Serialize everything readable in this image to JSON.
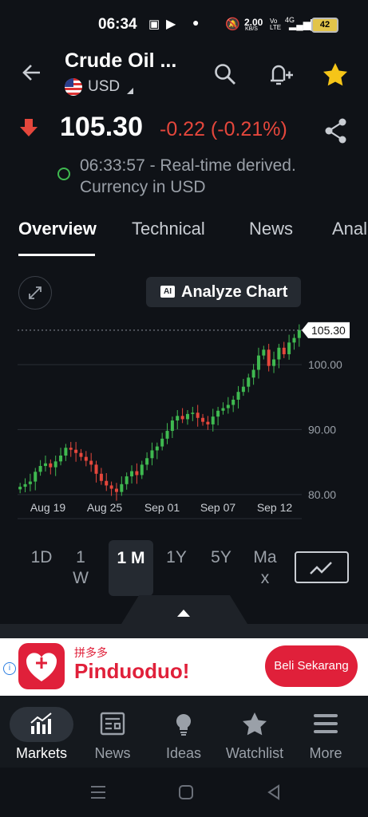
{
  "status_bar": {
    "time": "06:34",
    "net_speed": "2.00",
    "net_unit": "KB/S",
    "volte": "Vo LTE",
    "signal": "4G",
    "battery": "42"
  },
  "header": {
    "title": "Crude Oil ...",
    "currency": "USD"
  },
  "quote": {
    "price": "105.30",
    "change": "-0.22 (-0.21%)",
    "timestamp_line1": "06:33:57 - Real-time derived.",
    "timestamp_line2": "Currency in USD",
    "colors": {
      "down": "#e5473c",
      "up": "#3fb950"
    }
  },
  "tabs": [
    "Overview",
    "Technical",
    "News",
    "Anal"
  ],
  "analyze_button": {
    "badge": "AI",
    "label": "Analyze Chart"
  },
  "chart_data": {
    "type": "candlestick",
    "x_tick_labels": [
      "Aug 19",
      "Aug 25",
      "Sep 01",
      "Sep 07",
      "Sep 12"
    ],
    "y_tick_labels": [
      "80.00",
      "90.00",
      "100.00"
    ],
    "last_price_label": "105.30",
    "ylim": [
      79,
      107
    ],
    "close_series": [
      81.2,
      81.6,
      82.0,
      83.5,
      84.4,
      84.8,
      84.2,
      85.1,
      86.0,
      87.2,
      86.9,
      86.4,
      85.8,
      85.2,
      84.6,
      83.2,
      82.1,
      81.4,
      80.9,
      80.4,
      81.6,
      82.8,
      83.6,
      83.0,
      84.6,
      85.6,
      86.8,
      87.4,
      88.6,
      89.8,
      91.4,
      92.1,
      91.6,
      92.4,
      92.6,
      91.8,
      91.2,
      90.8,
      92.0,
      92.9,
      93.3,
      93.8,
      94.6,
      95.8,
      96.6,
      98.0,
      99.2,
      101.4,
      102.3,
      99.8,
      100.8,
      102.6,
      101.6,
      103.4,
      104.1,
      105.3
    ]
  },
  "ranges": {
    "items": [
      "1D",
      "1 W",
      "1 M",
      "1Y",
      "5Y",
      "Ma x"
    ],
    "active": "1 M"
  },
  "ad": {
    "chinese": "拼多多",
    "brand": "Pinduoduo!",
    "cta": "Beli Sekarang"
  },
  "bottom_nav": [
    "Markets",
    "News",
    "Ideas",
    "Watchlist",
    "More"
  ]
}
